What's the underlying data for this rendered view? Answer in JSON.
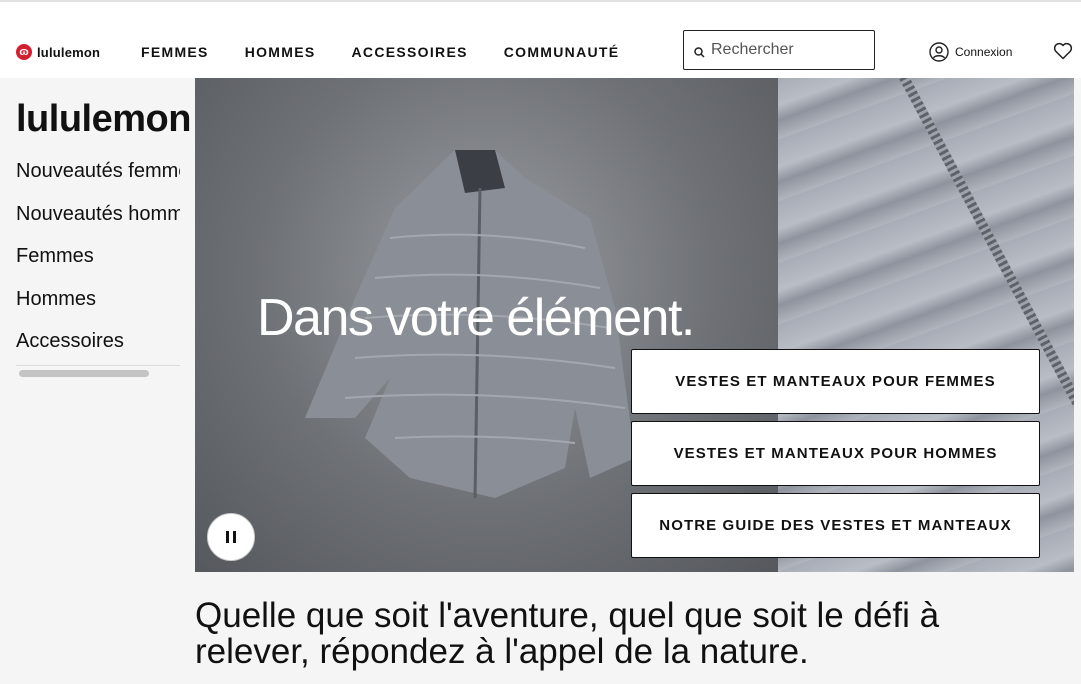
{
  "header": {
    "logo_text": "lululemon",
    "nav": [
      "FEMMES",
      "HOMMES",
      "ACCESSOIRES",
      "COMMUNAUTÉ"
    ],
    "search_placeholder": "Rechercher",
    "account_label": "Connexion",
    "icons": [
      "search-icon",
      "user-icon",
      "heart-icon"
    ]
  },
  "sidebar": {
    "brand": "lululemon",
    "items": [
      "Nouveautés femmes",
      "Nouveautés hommes",
      "Femmes",
      "Hommes",
      "Accessoires"
    ]
  },
  "hero": {
    "headline": "Dans votre élément.",
    "buttons": [
      "VESTES ET MANTEAUX POUR FEMMES",
      "VESTES ET MANTEAUX POUR HOMMES",
      "NOTRE GUIDE DES VESTES ET MANTEAUX"
    ]
  },
  "tagline": "Quelle que soit l'aventure, quel que soit le défi à relever, répondez à l'appel de la nature."
}
